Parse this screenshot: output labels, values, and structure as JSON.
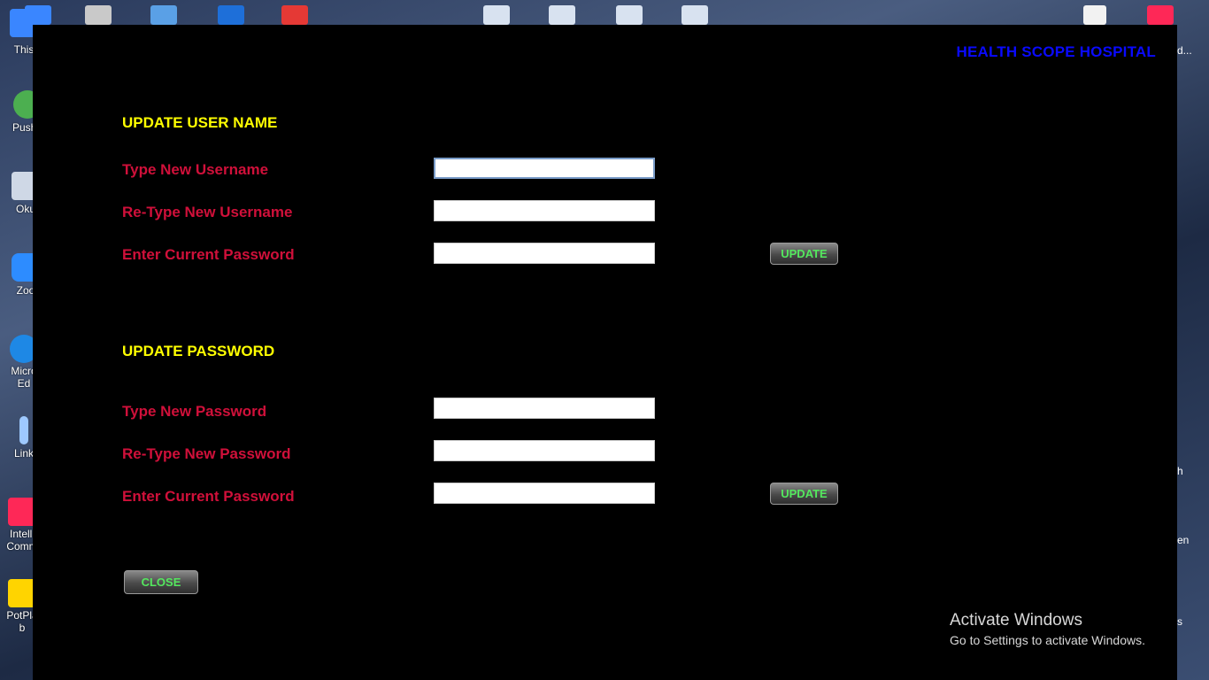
{
  "desktop": {
    "left_icons": [
      {
        "name": "this-pc-icon",
        "label": "This",
        "color": "#3a86ff"
      },
      {
        "name": "pushbullet-icon",
        "label": "Pushb",
        "color": "#4caf50"
      },
      {
        "name": "okular-icon",
        "label": "Oku",
        "color": "#cfd8e6"
      },
      {
        "name": "zoom-icon",
        "label": "Zoo",
        "color": "#2d8cff"
      },
      {
        "name": "edge-icon",
        "label": "Micro\nEd",
        "color": "#1e88e5"
      },
      {
        "name": "link-icon",
        "label": "Link",
        "color": "#9ec9ff"
      },
      {
        "name": "intellij-icon",
        "label": "Intelli\nComm",
        "color": "#fe2857"
      },
      {
        "name": "potplayer-icon",
        "label": "PotPla\nb",
        "color": "#ffd400"
      }
    ],
    "right_labels": [
      "d...",
      "h",
      "en",
      "s"
    ],
    "top_icons": [
      {
        "name": "folder-icon",
        "color": "#3a86ff"
      },
      {
        "name": "recycle-bin-icon",
        "color": "#c9c9c9"
      },
      {
        "name": "control-panel-icon",
        "color": "#5aa0e6"
      },
      {
        "name": "document-app-icon",
        "color": "#1e6fd9"
      },
      {
        "name": "pdffill-icon",
        "color": "#e53935"
      },
      {
        "name": "okular-icon",
        "color": "#d8e2f0"
      },
      {
        "name": "okular-icon",
        "color": "#d8e2f0"
      },
      {
        "name": "okular-icon",
        "color": "#d8e2f0"
      },
      {
        "name": "okular-icon",
        "color": "#d8e2f0"
      },
      {
        "name": "blank-file-icon",
        "color": "#f2f2f2"
      },
      {
        "name": "intellij-icon",
        "color": "#fe2857"
      }
    ]
  },
  "app": {
    "brand": "HEALTH SCOPE HOSPITAL",
    "username_section": {
      "title": "UPDATE USER NAME",
      "new_username_label": "Type New Username",
      "retype_username_label": "Re-Type New Username",
      "current_password_label": "Enter Current Password",
      "new_username_value": "",
      "retype_username_value": "",
      "current_password_value": "",
      "update_button": "UPDATE"
    },
    "password_section": {
      "title": "UPDATE PASSWORD",
      "new_password_label": "Type New Password",
      "retype_password_label": "Re-Type New Password",
      "current_password_label": "Enter Current Password",
      "new_password_value": "",
      "retype_password_value": "",
      "current_password_value": "",
      "update_button": "UPDATE"
    },
    "close_button": "CLOSE"
  },
  "watermark": {
    "line1": "Activate Windows",
    "line2": "Go to Settings to activate Windows."
  },
  "colors": {
    "window_bg": "#000000",
    "brand": "#0a0aff",
    "section_title": "#ffff00",
    "field_label": "#d0103a",
    "button_text": "#54e85e"
  }
}
